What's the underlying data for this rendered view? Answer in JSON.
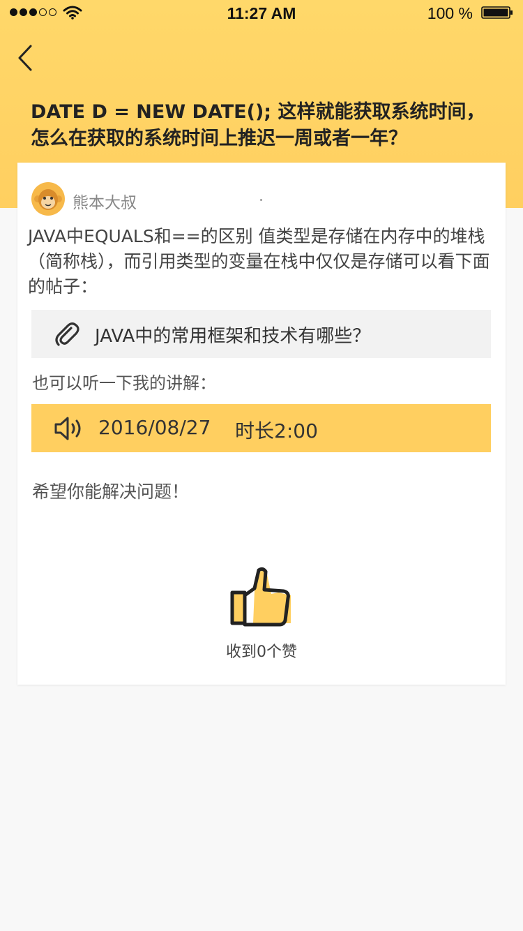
{
  "status_bar": {
    "time": "11:27 AM",
    "battery": "100 %",
    "signal_icon": "signal-dots-icon",
    "wifi_icon": "wifi-icon",
    "battery_icon": "battery-icon"
  },
  "nav": {
    "back_icon": "chevron-left-icon"
  },
  "question": {
    "title": "DATE D = NEW DATE(); 这样就能获取系统时间，怎么在获取的系统时间上推迟一周或者一年？"
  },
  "answer": {
    "author": "熊本大叔",
    "avatar_icon": "monkey-avatar",
    "body": "JAVA中EQUALS和==的区别 值类型是存储在内存中的堆栈（简称栈），而引用类型的变量在栈中仅仅是存储可以看下面的帖子：",
    "link": {
      "icon": "paperclip-icon",
      "label": "JAVA中的常用框架和技术有哪些？"
    },
    "listen_prompt": "也可以听一下我的讲解：",
    "audio": {
      "icon": "speaker-icon",
      "date": "2016/08/27",
      "duration": "时长2:00"
    },
    "closing": "希望你能解决问题！",
    "likes": {
      "icon": "thumbs-up-icon",
      "label": "收到0个赞"
    }
  },
  "colors": {
    "accent": "#ffcf60",
    "header": "#ffd86a",
    "background": "#f8f8f8",
    "card": "#ffffff",
    "link_bg": "#f2f2f2"
  }
}
